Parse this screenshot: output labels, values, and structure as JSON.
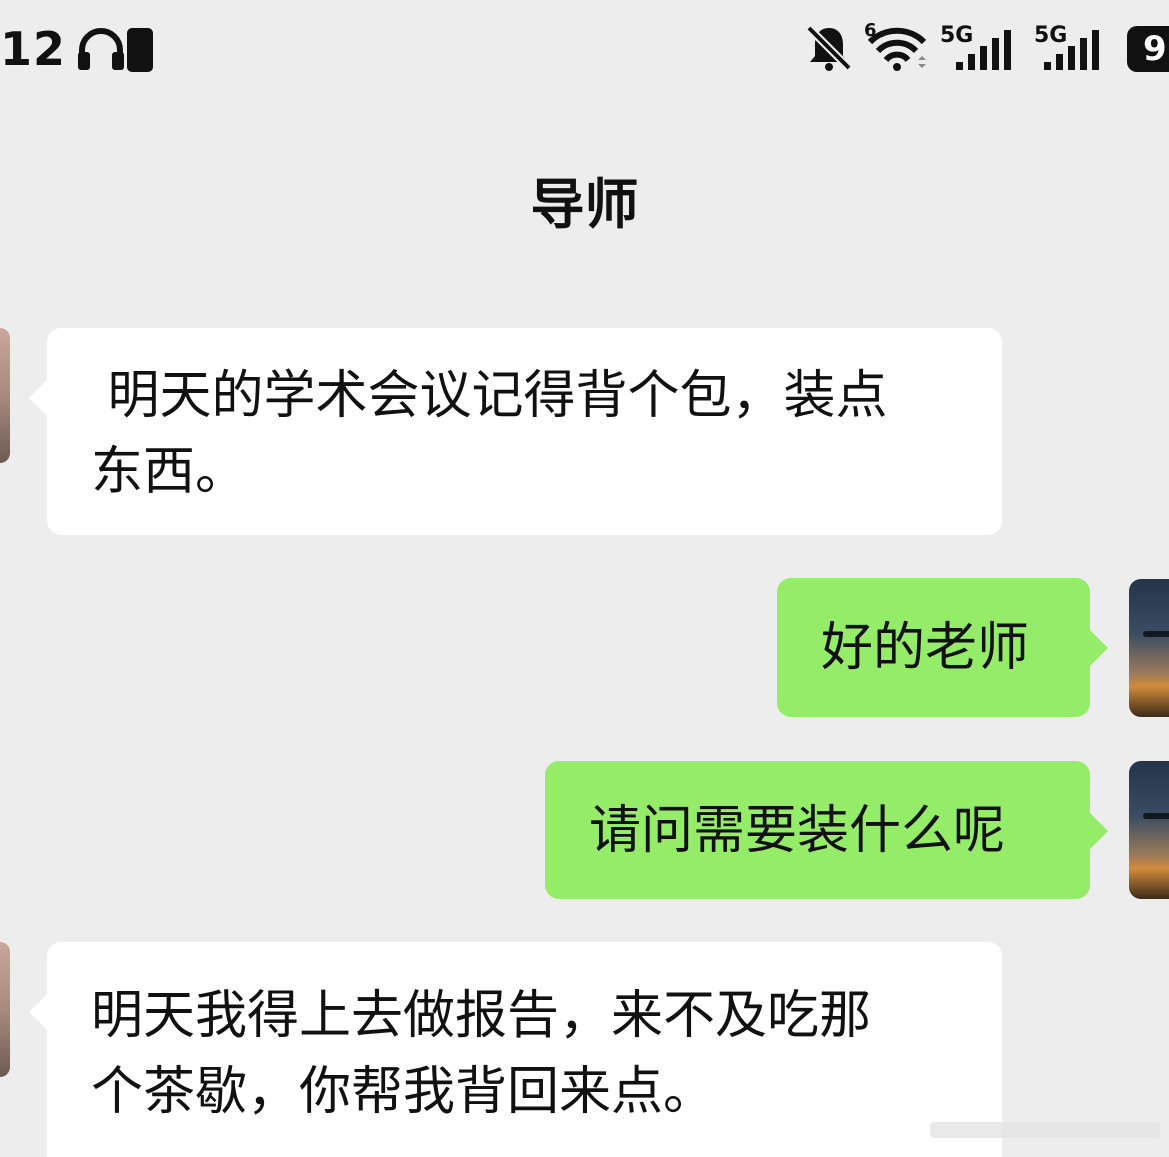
{
  "status_bar": {
    "time": "12",
    "icons": [
      "headset-icon",
      "mute-bell-icon",
      "wifi-icon",
      "signal-5g-icon",
      "signal-5g-icon",
      "battery-icon"
    ],
    "wifi_badge": "6",
    "network1": "5G",
    "network2": "5G",
    "battery": "9"
  },
  "chat": {
    "title": "导师",
    "messages": [
      {
        "side": "left",
        "text": " 明天的学术会议记得背个包，装点\n东西。"
      },
      {
        "side": "right",
        "text": "好的老师"
      },
      {
        "side": "right",
        "text": "请问需要装什么呢"
      },
      {
        "side": "left",
        "text": "明天我得上去做报告，来不及吃那\n个茶歇，你帮我背回来点。"
      }
    ]
  },
  "colors": {
    "background": "#ededed",
    "bubble_incoming": "#ffffff",
    "bubble_outgoing": "#95ec69",
    "text": "#111111"
  }
}
